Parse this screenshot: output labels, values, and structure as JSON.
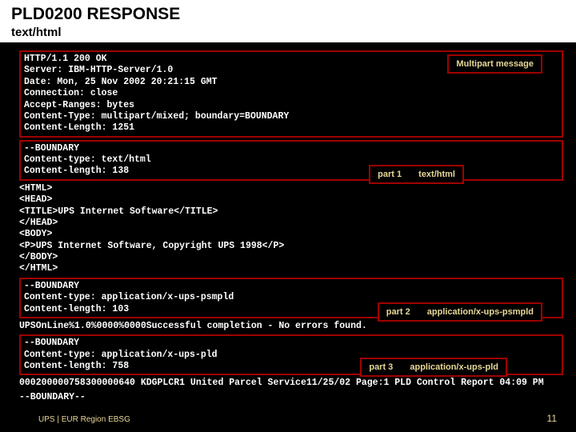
{
  "header": {
    "title": "PLD0200 RESPONSE",
    "subtitle": "text/html"
  },
  "labels": {
    "top": "Multipart message",
    "p1_num": "part 1",
    "p1_type": "text/html",
    "p2_num": "part 2",
    "p2_type": "application/x-ups-psmpld",
    "p3_num": "part 3",
    "p3_type": "application/x-ups-pld"
  },
  "blocks": {
    "httpHeaders": "HTTP/1.1 200 OK\nServer: IBM-HTTP-Server/1.0\nDate: Mon, 25 Nov 2002 20:21:15 GMT\nConnection: close\nAccept-Ranges: bytes\nContent-Type: multipart/mixed; boundary=BOUNDARY\nContent-Length: 1251",
    "part1Head": "--BOUNDARY\nContent-type: text/html\nContent-length: 138",
    "part1Body": "<HTML>\n<HEAD>\n<TITLE>UPS Internet Software</TITLE>\n</HEAD>\n<BODY>\n<P>UPS Internet Software, Copyright UPS 1998</P>\n</BODY>\n</HTML>",
    "part2Head": "--BOUNDARY\nContent-type: application/x-ups-psmpld\nContent-length: 103",
    "part2Body": "UPSOnLine%1.0%0000%0000Successful completion - No errors found.",
    "part3Head": "--BOUNDARY\nContent-type: application/x-ups-pld\nContent-length: 758",
    "part3Body": "000200000758300000640 KDGPLCR1 United Parcel Service11/25/02 Page:1 PLD Control Report 04:09 PM",
    "closing": "--BOUNDARY--"
  },
  "footer": {
    "left": "UPS | EUR Region EBSG",
    "pageNum": "11"
  }
}
